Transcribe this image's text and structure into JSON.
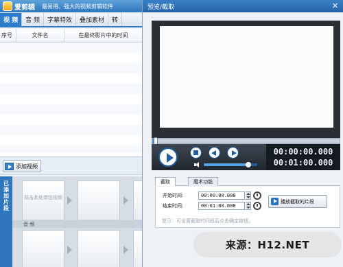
{
  "main_window": {
    "title": "爱剪辑",
    "slogan": "最易用、强大的视频剪辑软件",
    "tabs": [
      {
        "label": "视 频",
        "active": true
      },
      {
        "label": "音 频",
        "active": false
      },
      {
        "label": "字幕特效",
        "active": false
      },
      {
        "label": "叠加素材",
        "active": false
      },
      {
        "label": "转",
        "active": false
      }
    ],
    "file_list": {
      "columns": [
        "序号",
        "文件名",
        "在最终影片中的时间"
      ],
      "rows": []
    },
    "add_video_label": "添加视频",
    "side_tab_label": "已添加片段",
    "timeline": {
      "slot_hint": "双击此处添加视频",
      "audio_label": "音 频"
    }
  },
  "preview_dialog": {
    "title": "预览/截取",
    "close_glyph": "×",
    "seek_progress": 0.01,
    "volume_level": 0.83,
    "current_time": "00:00:00.000",
    "total_time": "00:01:00.000",
    "tabs": [
      {
        "label": "截取",
        "active": true
      },
      {
        "label": "魔术功能",
        "active": false
      }
    ],
    "start_label": "开始时间:",
    "start_value": "00:00:00.000",
    "end_label": "结束时间:",
    "end_value": "00:01:00.000",
    "play_clip_label": "播放截取的片段",
    "hint": "提示：可设置截取时间段后点击确定按钮。"
  },
  "watermark": "来源：H12.NET",
  "colors": {
    "accent": "#2d7cc9",
    "player_dark": "#20262d",
    "watermark_bg": "#e4e4e4"
  }
}
